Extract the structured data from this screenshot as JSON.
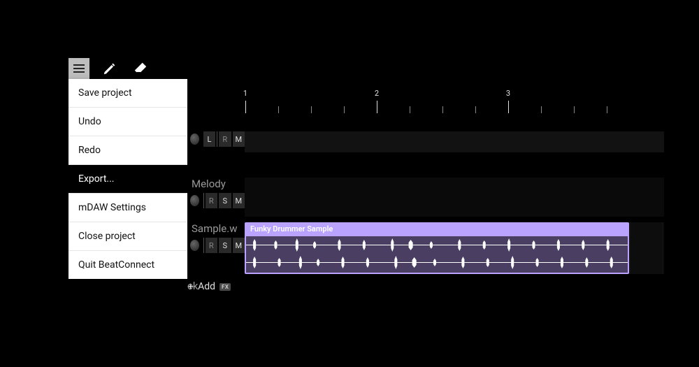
{
  "toolbar": {
    "menu_icon": "hamburger",
    "pencil_icon": "pencil",
    "eraser_icon": "eraser"
  },
  "menu": {
    "items": [
      {
        "label": "Save project",
        "selected": false
      },
      {
        "label": "Undo",
        "selected": false
      },
      {
        "label": "Redo",
        "selected": false
      },
      {
        "label": "Export...",
        "selected": true
      },
      {
        "label": "mDAW Settings",
        "selected": false
      },
      {
        "label": "Close project",
        "selected": false
      },
      {
        "label": "Quit BeatConnect",
        "selected": false
      }
    ]
  },
  "ruler": {
    "bars": [
      "1",
      "2",
      "3"
    ]
  },
  "tracks": {
    "t0": {
      "btn_l": "L",
      "btn_r": "R",
      "btn_m": "M"
    },
    "t1": {
      "name": "Melody",
      "btn_r": "R",
      "btn_s": "S",
      "btn_m": "M"
    },
    "t2": {
      "name": "Sample.w",
      "btn_r": "R",
      "btn_s": "S",
      "btn_m": "M",
      "clip_label": "Funky Drummer Sample"
    },
    "add": {
      "label": "Add",
      "fx": "FX"
    },
    "truncated": "ck"
  },
  "colors": {
    "clip_border": "#b9a3ff",
    "clip_fill": "#4a3f63"
  }
}
